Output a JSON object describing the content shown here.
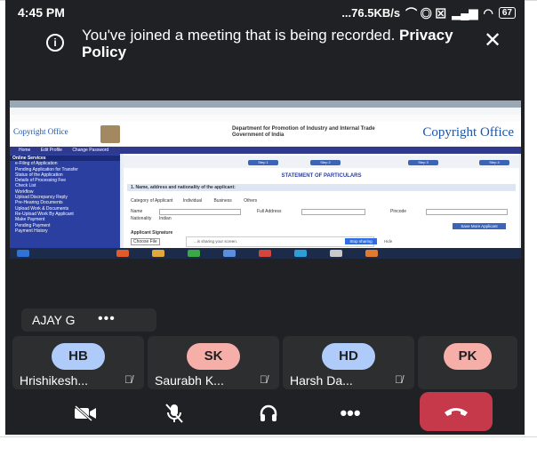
{
  "status_bar": {
    "time": "4:45 PM",
    "speed": "...76.5KB/s",
    "battery": "67"
  },
  "banner": {
    "text": "You've joined a meeting that is being recorded.",
    "link": "Privacy Policy"
  },
  "shared_screen": {
    "site_logo_left": "Copyright Office",
    "department": "Department for Promotion of Industry and Internal Trade",
    "department_line2": "Government of India",
    "site_logo_right": "Copyright Office",
    "nav": [
      "Home",
      "Edit Profile",
      "Change Password"
    ],
    "sidebar_header": "Online Services",
    "sidebar_items": [
      "e-Filing of Application",
      "Pending Application for Transfer",
      "Status of the Application",
      "Details of Processing Fee",
      "Check List",
      "Workflow",
      "Upload Discrepancy Reply",
      "Pre-Hearing Documents",
      "Upload Work & Documents",
      "Re-Upload Work By Applicant",
      "Make Payment",
      "Pending Payment",
      "Payment History"
    ],
    "steps": [
      "Step 1",
      "Step 2",
      "Step 3",
      "Step 4"
    ],
    "statement_title": "STATEMENT OF PARTICULARS",
    "section_title": "1. Name, address and nationality of the applicant:",
    "category_label": "Category of Applicant",
    "categories": [
      "Individual",
      "Business",
      "Others"
    ],
    "name_label": "Name",
    "address_label": "Full Address",
    "pincode_label": "Pincode",
    "nationality_label": "Nationality",
    "nationality_value": "Indian",
    "save_button": "Save More Applicant",
    "signature_label": "Applicant Signature",
    "choose_file": "Choose File",
    "sharing_text": "...is sharing your screen.",
    "stop_sharing": "Stop sharing",
    "hide": "Hide"
  },
  "presenter_chip": {
    "name": "AJAY G",
    "more": "•••"
  },
  "participants": [
    {
      "initials": "HB",
      "name": "Hrishikesh...",
      "color": "#aecbfa"
    },
    {
      "initials": "SK",
      "name": "Saurabh K...",
      "color": "#f6aea9"
    },
    {
      "initials": "HD",
      "name": "Harsh Da...",
      "color": "#aecbfa"
    },
    {
      "initials": "PK",
      "name": "",
      "color": "#f6aea9"
    }
  ],
  "controls": {
    "more": "•••"
  }
}
